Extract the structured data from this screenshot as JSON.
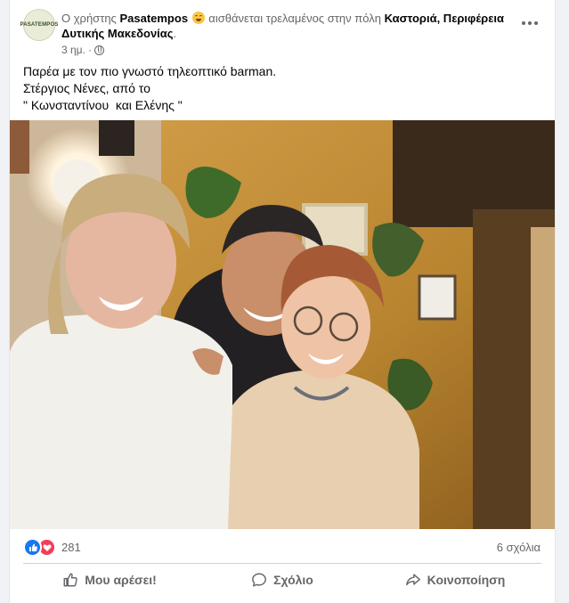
{
  "header": {
    "avatar_label": "PASATEMPOS",
    "prefix": "Ο χρήστης",
    "user": "Pasatempos",
    "feeling": "αισθάνεται τρελαμένος στην πόλη",
    "place": "Καστοριά, Περιφέρεια Δυτικής Μακεδονίας",
    "period": ".",
    "time": "3 ημ.",
    "separator": "·"
  },
  "post": {
    "lines": [
      "Παρέα με τον πιο γνωστό τηλεοπτικό barman.",
      "Στέργιος Νένες, από το",
      "\" Κωνσταντίνου  και Ελένης \""
    ]
  },
  "stats": {
    "reaction_count": "281",
    "comments": "6 σχόλια"
  },
  "actions": {
    "like": "Μου αρέσει!",
    "comment": "Σχόλιο",
    "share": "Κοινοποίηση"
  },
  "icons": {
    "like": "thumbs-up-icon",
    "love": "heart-icon",
    "comment": "comment-icon",
    "share": "share-arrow-icon",
    "more": "more-horizontal-icon",
    "audience": "globe-icon"
  },
  "colors": {
    "like_blue": "#1877f2",
    "love_red": "#f33e58",
    "secondary_text": "#65676b"
  }
}
